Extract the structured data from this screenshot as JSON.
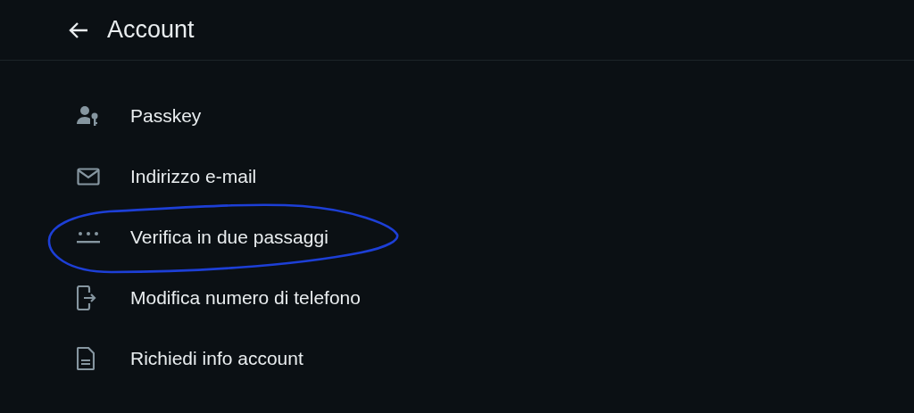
{
  "header": {
    "title": "Account"
  },
  "items": [
    {
      "label": "Passkey",
      "circled": false
    },
    {
      "label": "Indirizzo e-mail",
      "circled": false
    },
    {
      "label": "Verifica in due passaggi",
      "circled": true
    },
    {
      "label": "Modifica numero di telefono",
      "circled": false
    },
    {
      "label": "Richiedi info account",
      "circled": false
    }
  ]
}
